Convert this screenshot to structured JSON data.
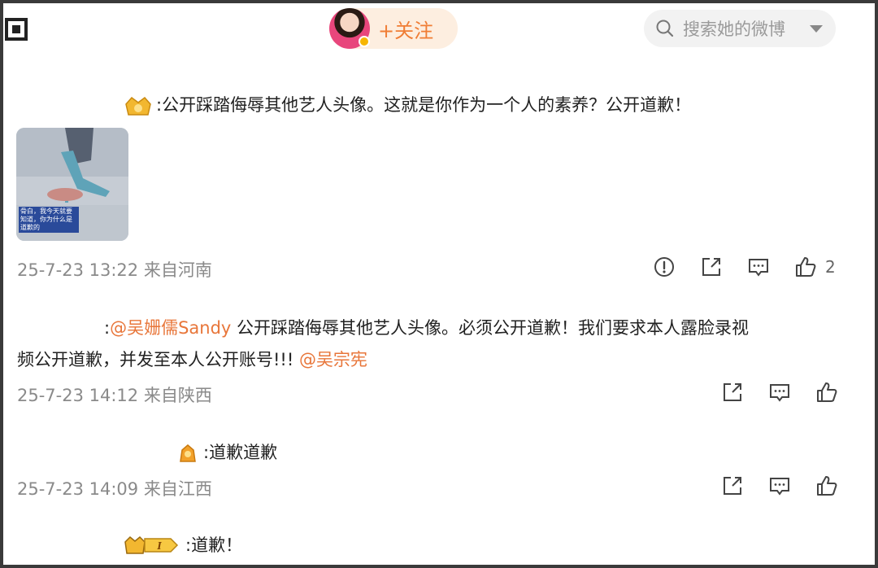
{
  "header": {
    "follow_label": "+关注",
    "search_placeholder": "搜索她的微博"
  },
  "comments": [
    {
      "text": ":公开踩踏侮辱其他艺人头像。这就是你作为一个人的素养？公开道歉！",
      "image_caption": "骨白，我今天就要知道，你为什么是道歉的",
      "timestamp": "25-7-23 13:22 来自河南",
      "like_count": "2"
    },
    {
      "prefix": ":",
      "mention1": "@吴姗儒Sandy",
      "text_line1": " 公开踩踏侮辱其他艺人头像。必须公开道歉！我们要求本人露脸录视",
      "text_line2": "频公开道歉，并发至本人公开账号!!! ",
      "mention2": "@吴宗宪",
      "timestamp": "25-7-23 14:12 来自陕西"
    },
    {
      "text": ":道歉道歉",
      "timestamp": "25-7-23 14:09 来自江西"
    },
    {
      "badge_level": "I",
      "text": ":道歉！"
    }
  ],
  "colors": {
    "accent": "#f07d35",
    "mention": "#e8763a",
    "meta": "#8a8a8a"
  }
}
